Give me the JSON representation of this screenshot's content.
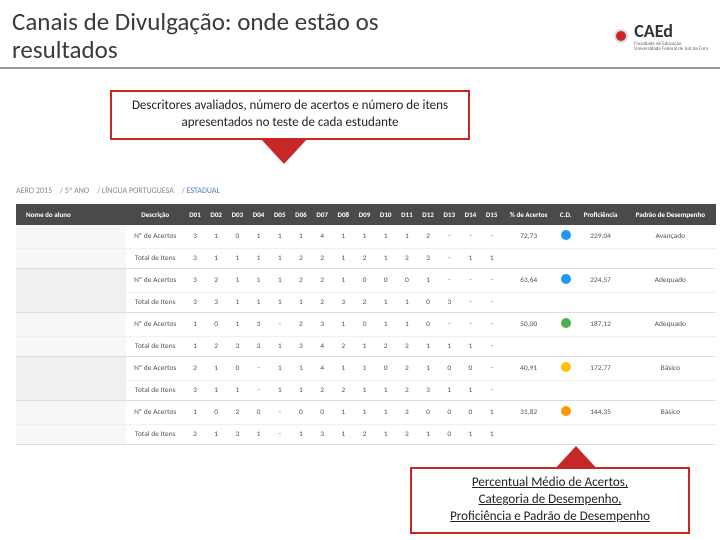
{
  "header": {
    "title": "Canais de Divulgação: onde estão os resultados",
    "logo_text": "CAEd",
    "logo_sub1": "Faculdade de Educação",
    "logo_sub2": "Universidade Federal de Juiz de Fora"
  },
  "callout1": {
    "line": "Descritores avaliados, número de acertos e número de itens apresentados no teste de cada estudante"
  },
  "callout2": {
    "l1": "Percentual Médio de Acertos,",
    "l2": "Categoria de Desempenho,",
    "l3": "Proficiência e Padrão de Desempenho"
  },
  "breadcrumb": {
    "a": "AERO 2015",
    "b": "5º ANO",
    "c": "LÍNGUA PORTUGUESA",
    "d": "ESTADUAL"
  },
  "thead": {
    "c0": "Nome do aluno",
    "c1": "Descrição",
    "d1": "D01",
    "d2": "D02",
    "d3": "D03",
    "d4": "D04",
    "d5": "D05",
    "d6": "D06",
    "d7": "D07",
    "d8": "D08",
    "d9": "D09",
    "d10": "D10",
    "d11": "D11",
    "d12": "D12",
    "d13": "D13",
    "d14": "D14",
    "d15": "D15",
    "pct": "% de Acertos",
    "cd": "C.D.",
    "prof": "Proficiência",
    "padrao": "Padrão de Desempenho"
  },
  "rows": [
    {
      "desc": "Nº de Acertos",
      "d": [
        "3",
        "1",
        "0",
        "1",
        "1",
        "1",
        "4",
        "1",
        "1",
        "1",
        "1",
        "2",
        "-",
        "-",
        "-"
      ],
      "pct": "72,73",
      "cd": "blue",
      "prof": "229,04",
      "padrao": "Avançado"
    },
    {
      "desc": "Total de Itens",
      "d": [
        "3",
        "1",
        "1",
        "1",
        "1",
        "2",
        "2",
        "1",
        "2",
        "1",
        "2",
        "3",
        "-",
        "1",
        "1"
      ],
      "pct": "",
      "cd": "",
      "prof": "",
      "padrao": ""
    },
    {
      "desc": "Nº de Acertos",
      "d": [
        "3",
        "2",
        "1",
        "1",
        "1",
        "2",
        "2",
        "1",
        "0",
        "0",
        "0",
        "1",
        "-",
        "-",
        "-"
      ],
      "pct": "63,64",
      "cd": "blue",
      "prof": "224,57",
      "padrao": "Adequado"
    },
    {
      "desc": "Total de Itens",
      "d": [
        "3",
        "3",
        "1",
        "1",
        "1",
        "1",
        "2",
        "3",
        "2",
        "1",
        "1",
        "0",
        "3",
        "-",
        "-"
      ],
      "pct": "",
      "cd": "",
      "prof": "",
      "padrao": ""
    },
    {
      "desc": "Nº de Acertos",
      "d": [
        "1",
        "0",
        "1",
        "3",
        "-",
        "2",
        "3",
        "1",
        "0",
        "1",
        "1",
        "0",
        "-",
        "-",
        "-"
      ],
      "pct": "50,00",
      "cd": "green",
      "prof": "187,12",
      "padrao": "Adequado"
    },
    {
      "desc": "Total de Itens",
      "d": [
        "1",
        "2",
        "3",
        "3",
        "1",
        "3",
        "4",
        "2",
        "1",
        "2",
        "2",
        "1",
        "1",
        "1",
        "-"
      ],
      "pct": "",
      "cd": "",
      "prof": "",
      "padrao": ""
    },
    {
      "desc": "Nº de Acertos",
      "d": [
        "2",
        "1",
        "0",
        "-",
        "1",
        "1",
        "4",
        "1",
        "1",
        "0",
        "2",
        "1",
        "0",
        "0",
        "-"
      ],
      "pct": "40,91",
      "cd": "yellow",
      "prof": "172,77",
      "padrao": "Básico"
    },
    {
      "desc": "Total de Itens",
      "d": [
        "3",
        "1",
        "1",
        "-",
        "1",
        "1",
        "2",
        "2",
        "1",
        "1",
        "2",
        "3",
        "1",
        "1",
        "-"
      ],
      "pct": "",
      "cd": "",
      "prof": "",
      "padrao": ""
    },
    {
      "desc": "Nº de Acertos",
      "d": [
        "1",
        "0",
        "2",
        "0",
        "-",
        "0",
        "0",
        "1",
        "1",
        "1",
        "2",
        "0",
        "0",
        "0",
        "1"
      ],
      "pct": "31,82",
      "cd": "orange",
      "prof": "144,35",
      "padrao": "Básico"
    },
    {
      "desc": "Total de Itens",
      "d": [
        "2",
        "1",
        "3",
        "1",
        "-",
        "1",
        "3",
        "1",
        "2",
        "1",
        "2",
        "1",
        "0",
        "1",
        "1"
      ],
      "pct": "",
      "cd": "",
      "prof": "",
      "padrao": ""
    }
  ]
}
